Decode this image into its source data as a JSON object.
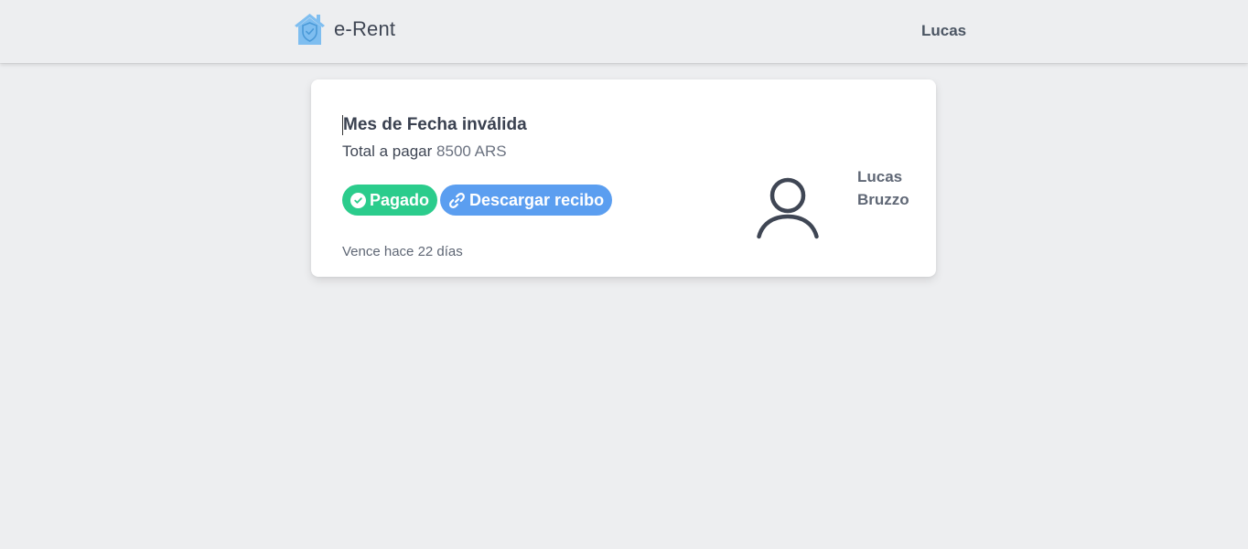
{
  "navbar": {
    "brand_name": "e-Rent",
    "logo_icon": "house-shield-icon",
    "user_name": "Lucas",
    "accent_color": "#7fbef0"
  },
  "payment_card": {
    "title": "Mes de Fecha inválida",
    "total_label": "Total a pagar",
    "total_amount": "8500 ARS",
    "status_badge": {
      "label": "Pagado",
      "icon": "check-circle-icon",
      "color": "#2bcc8c"
    },
    "receipt_button": {
      "label": "Descargar recibo",
      "icon": "link-icon",
      "color": "#5b9ef0"
    },
    "due_text": "Vence hace 22 días",
    "tenant": {
      "avatar_icon": "user-icon",
      "first_name": "Lucas",
      "last_name": "Bruzzo"
    }
  }
}
